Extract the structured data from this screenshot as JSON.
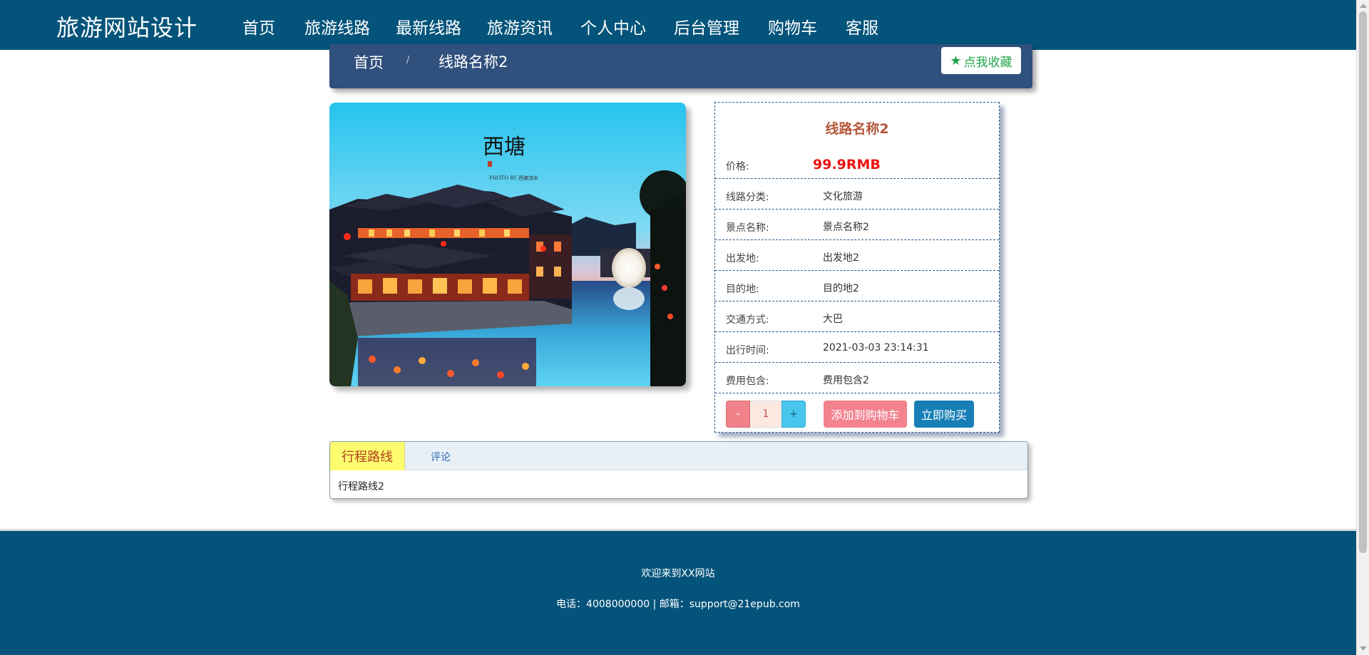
{
  "brand": "旅游网站设计",
  "nav": {
    "items": [
      "首页",
      "旅游线路",
      "最新线路",
      "旅游资讯",
      "个人中心",
      "后台管理",
      "购物车",
      "客服"
    ]
  },
  "breadcrumb": {
    "home": "首页",
    "separator": "/",
    "current": "线路名称2"
  },
  "favorite_label": "点我收藏",
  "favorite_icon": "star-icon",
  "route": {
    "name": "线路名称2",
    "price_label": "价格:",
    "price_value": "99.9RMB",
    "rows": [
      {
        "label": "线路分类:",
        "value": "文化旅游"
      },
      {
        "label": "景点名称:",
        "value": "景点名称2"
      },
      {
        "label": "出发地:",
        "value": "出发地2"
      },
      {
        "label": "目的地:",
        "value": "目的地2"
      },
      {
        "label": "交通方式:",
        "value": "大巴"
      },
      {
        "label": "出行时间:",
        "value": "2021-03-03 23:14:31"
      },
      {
        "label": "费用包含:",
        "value": "费用包含2"
      }
    ]
  },
  "photo": {
    "calligraphy": "西塘",
    "credit": "PHOTO BY 西塘流水"
  },
  "quantity": {
    "minus": "-",
    "value": "1",
    "plus": "+"
  },
  "buttons": {
    "add_to_cart": "添加到购物车",
    "buy_now": "立即购买"
  },
  "tabs": {
    "items": [
      "行程路线",
      "评论"
    ],
    "active_content": "行程路线2"
  },
  "footer": {
    "welcome": "欢迎来到XX网站",
    "contact": "电话：4008000000 | 邮箱：support@21epub.com"
  },
  "colors": {
    "nav_bg": "#03537a",
    "breadcrumb_bg": "#30507d",
    "price": "#ee1212",
    "route_title": "#b4573b",
    "favorite": "#1ea54b",
    "add_to_cart": "#f2828e",
    "buy_now": "#187fb6",
    "active_tab": "#fdfc6e"
  }
}
